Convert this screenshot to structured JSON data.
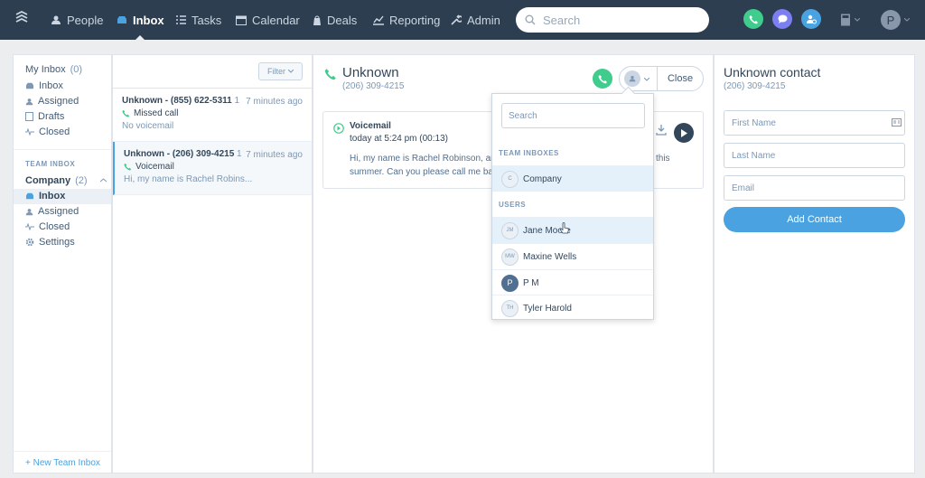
{
  "nav": {
    "items": [
      {
        "label": "People",
        "icon": "people-icon"
      },
      {
        "label": "Inbox",
        "icon": "inbox-icon",
        "active": true
      },
      {
        "label": "Tasks",
        "icon": "tasks-icon"
      },
      {
        "label": "Calendar",
        "icon": "calendar-icon"
      },
      {
        "label": "Deals",
        "icon": "deals-icon"
      },
      {
        "label": "Reporting",
        "icon": "reporting-icon"
      },
      {
        "label": "Admin",
        "icon": "admin-icon"
      }
    ],
    "search_placeholder": "Search",
    "avatar_initial": "P"
  },
  "colors": {
    "topbar": "#2d3e50",
    "green": "#3fcc8c",
    "purple": "#7b7ff2",
    "blue": "#4aa3e0"
  },
  "sidebar": {
    "my_inbox": {
      "label": "My Inbox",
      "count": "(0)"
    },
    "my_items": [
      "Inbox",
      "Assigned",
      "Drafts",
      "Closed"
    ],
    "team_header": "TEAM INBOX",
    "company": {
      "label": "Company",
      "count": "(2)"
    },
    "company_items": [
      "Inbox",
      "Assigned",
      "Closed",
      "Settings"
    ],
    "new_inbox": "+ New Team Inbox"
  },
  "list": {
    "filter_label": "Filter",
    "conversations": [
      {
        "title": "Unknown - (855) 622-5311",
        "count": "1",
        "time": "7 minutes ago",
        "type": "Missed call",
        "preview": "No voicemail"
      },
      {
        "title": "Unknown - (206) 309-4215",
        "count": "1",
        "time": "7 minutes ago",
        "type": "Voicemail",
        "preview": "Hi, my name is Rachel Robins..."
      }
    ]
  },
  "thread": {
    "name": "Unknown",
    "phone": "(206) 309-4215",
    "close_label": "Close",
    "voicemail": {
      "title": "Voicemail",
      "meta": "today at 5:24 pm (00:13)",
      "text_line1": "Hi, my name is Rachel Robinson, and",
      "text_line1_tail": "this",
      "text_line2": "summer. Can you please call me back"
    }
  },
  "assign_dropdown": {
    "search_placeholder": "Search",
    "team_header": "TEAM INBOXES",
    "teams": [
      {
        "initials": "C",
        "name": "Company"
      }
    ],
    "users_header": "USERS",
    "users": [
      {
        "initials": "JM",
        "name": "Jane Moore"
      },
      {
        "initials": "MW",
        "name": "Maxine Wells"
      },
      {
        "initials": "P",
        "name": "P M"
      },
      {
        "initials": "TH",
        "name": "Tyler Harold"
      }
    ]
  },
  "contact": {
    "name": "Unknown contact",
    "phone": "(206) 309-4215",
    "first_name_placeholder": "First Name",
    "last_name_placeholder": "Last Name",
    "email_placeholder": "Email",
    "add_label": "Add Contact"
  }
}
